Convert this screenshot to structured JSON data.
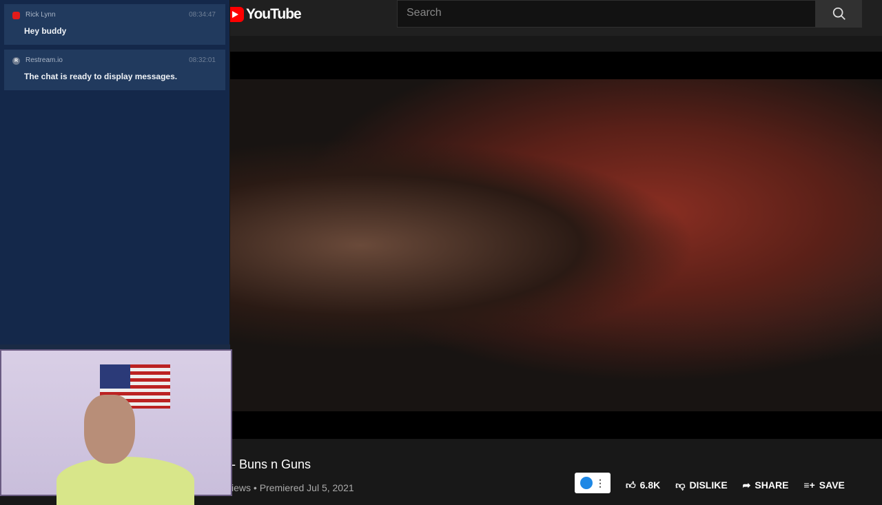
{
  "chat": {
    "messages": [
      {
        "source": "youtube-icon",
        "name": "Rick Lynn",
        "time": "08:34:47",
        "text": "Hey buddy"
      },
      {
        "source": "restream-icon",
        "source_letter": "R",
        "name": "Restream.io",
        "time": "08:32:01",
        "text": "The chat is ready to display messages."
      }
    ]
  },
  "youtube": {
    "logo": "YouTube",
    "search_placeholder": "Search",
    "video_title": "- Buns n Guns",
    "video_meta": "iews • Premiered Jul 5, 2021",
    "likes": "6.8K",
    "dislike_label": "DISLIKE",
    "share_label": "SHARE",
    "save_label": "SAVE"
  },
  "colors": {
    "chat_bg": "#14284a",
    "message_bg": "#213a5e",
    "youtube_red": "#ff0000"
  }
}
